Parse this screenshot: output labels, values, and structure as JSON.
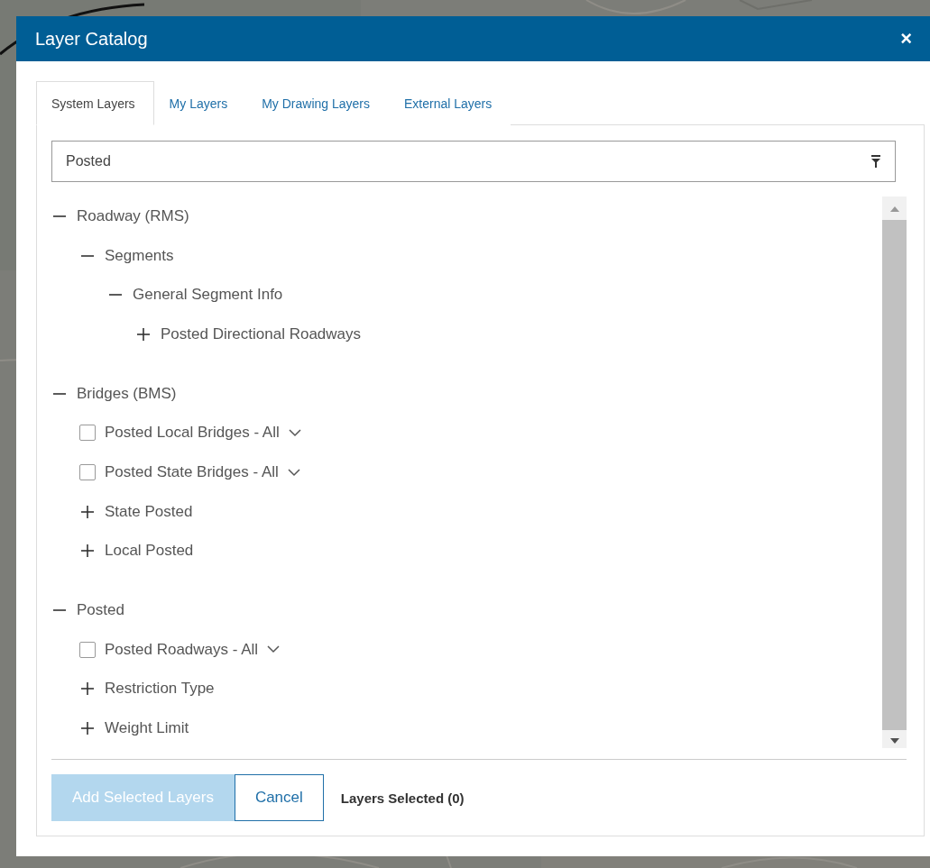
{
  "dialog": {
    "title": "Layer Catalog",
    "close": "×"
  },
  "tabs": [
    {
      "label": "System Layers",
      "selected": true
    },
    {
      "label": "My Layers",
      "selected": false
    },
    {
      "label": "My Drawing Layers",
      "selected": false
    },
    {
      "label": "External Layers",
      "selected": false
    }
  ],
  "search": {
    "value": "Posted"
  },
  "tree": [
    {
      "kind": "group",
      "label": "Roadway (RMS)",
      "expanded": true,
      "children": [
        {
          "kind": "group",
          "label": "Segments",
          "expanded": true,
          "children": [
            {
              "kind": "group",
              "label": "General Segment Info",
              "expanded": true,
              "children": [
                {
                  "kind": "group",
                  "label": "Posted Directional Roadways",
                  "expanded": false
                }
              ]
            }
          ]
        }
      ]
    },
    {
      "kind": "group",
      "label": "Bridges (BMS)",
      "expanded": true,
      "children": [
        {
          "kind": "layer",
          "label": "Posted Local Bridges - All",
          "checked": false
        },
        {
          "kind": "layer",
          "label": "Posted State Bridges - All",
          "checked": false
        },
        {
          "kind": "group",
          "label": "State Posted",
          "expanded": false
        },
        {
          "kind": "group",
          "label": "Local Posted",
          "expanded": false
        }
      ]
    },
    {
      "kind": "group",
      "label": "Posted",
      "expanded": true,
      "children": [
        {
          "kind": "layer",
          "label": "Posted Roadways - All",
          "checked": false
        },
        {
          "kind": "group",
          "label": "Restriction Type",
          "expanded": false
        },
        {
          "kind": "group",
          "label": "Weight Limit",
          "expanded": false
        }
      ]
    }
  ],
  "footer": {
    "add_button": {
      "label": "Add Selected Layers",
      "disabled": true
    },
    "cancel_button": "Cancel",
    "status": "Layers Selected (0)"
  }
}
